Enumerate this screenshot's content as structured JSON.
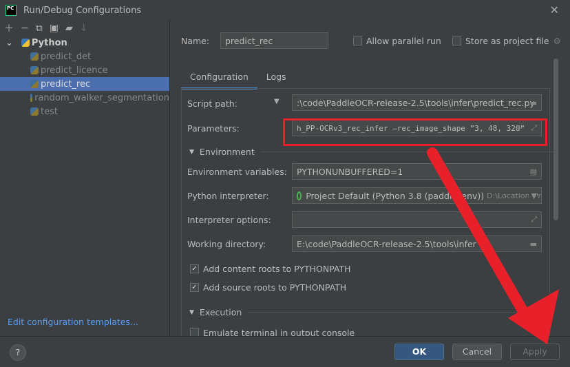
{
  "window": {
    "title": "Run/Debug Configurations",
    "logo": "PC"
  },
  "toolbar": [
    "add-icon",
    "remove-icon",
    "copy-icon",
    "save-icon",
    "folder-add-icon",
    "sort-icon"
  ],
  "tree": {
    "root": "Python",
    "items": [
      {
        "label": "predict_det"
      },
      {
        "label": "predict_licence"
      },
      {
        "label": "predict_rec",
        "selected": true
      },
      {
        "label": "random_walker_segmentation"
      },
      {
        "label": "test"
      }
    ]
  },
  "edit_templates": "Edit configuration templates...",
  "name": {
    "label": "Name:",
    "value": "predict_rec"
  },
  "allow_parallel": {
    "label": "Allow parallel run",
    "checked": false
  },
  "store_project": {
    "label": "Store as project file",
    "checked": false
  },
  "tabs": [
    {
      "label": "Configuration",
      "active": true
    },
    {
      "label": "Logs"
    }
  ],
  "form": {
    "script_label": "Script path:",
    "script_value": ":\\code\\PaddleOCR-release-2.5\\tools\\infer\\predict_rec.py",
    "params_label": "Parameters:",
    "params_value": "h_PP-OCRv3_rec_infer —rec_image_shape ”3, 48, 320”",
    "env_section": "Environment",
    "envvars_label": "Environment variables:",
    "envvars_value": "PYTHONUNBUFFERED=1",
    "interp_label": "Python interpreter:",
    "interp_value": "Project Default (Python 3.8 (paddle_env))",
    "interp_path": "D:\\Location_Pr",
    "interp_opts_label": "Interpreter options:",
    "interp_opts_value": "",
    "workdir_label": "Working directory:",
    "workdir_value": "E:\\code\\PaddleOCR-release-2.5\\tools\\infer",
    "content_roots": {
      "label": "Add content roots to PYTHONPATH",
      "checked": true
    },
    "source_roots": {
      "label": "Add source roots to PYTHONPATH",
      "checked": true
    },
    "exec_section": "Execution",
    "emulate": {
      "label": "Emulate terminal in output console",
      "checked": false
    }
  },
  "buttons": {
    "help": "?",
    "ok": "OK",
    "cancel": "Cancel",
    "apply": "Apply"
  },
  "colors": {
    "highlight": "#e8202a",
    "selection": "#4b6eaf",
    "ok": "#365880"
  }
}
